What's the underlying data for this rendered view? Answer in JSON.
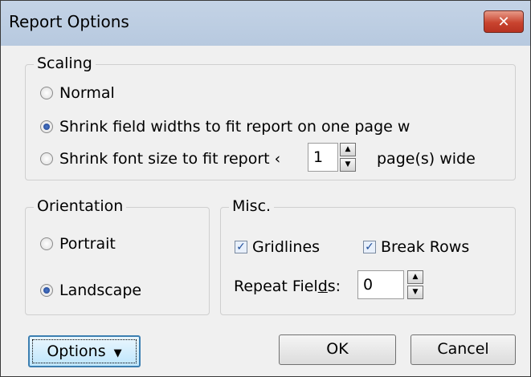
{
  "window": {
    "title": "Report Options",
    "close_glyph": "✕"
  },
  "scaling": {
    "legend": "Scaling",
    "normal_label": "Normal",
    "shrink_width_label": "Shrink field widths to fit report on one page w",
    "shrink_font_prefix": "Shrink font size to fit report ‹",
    "pages_value": "1",
    "pages_suffix": "page(s) wide",
    "selected": "shrink_width"
  },
  "orientation": {
    "legend": "Orientation",
    "portrait_label": "Portrait",
    "landscape_label": "Landscape",
    "selected": "landscape"
  },
  "misc": {
    "legend": "Misc.",
    "gridlines_label": "Gridlines",
    "gridlines_checked": true,
    "break_rows_label": "Break Rows",
    "break_rows_checked": true,
    "repeat_fields_pre": "Repeat Fiel",
    "repeat_fields_mnemonic": "d",
    "repeat_fields_post": "s:",
    "repeat_fields_value": "0"
  },
  "buttons": {
    "options_label": "Options",
    "options_arrow": "▼",
    "ok_label": "OK",
    "cancel_label": "Cancel"
  },
  "icons": {
    "check": "✓",
    "spin_up": "▲",
    "spin_down": "▼"
  }
}
